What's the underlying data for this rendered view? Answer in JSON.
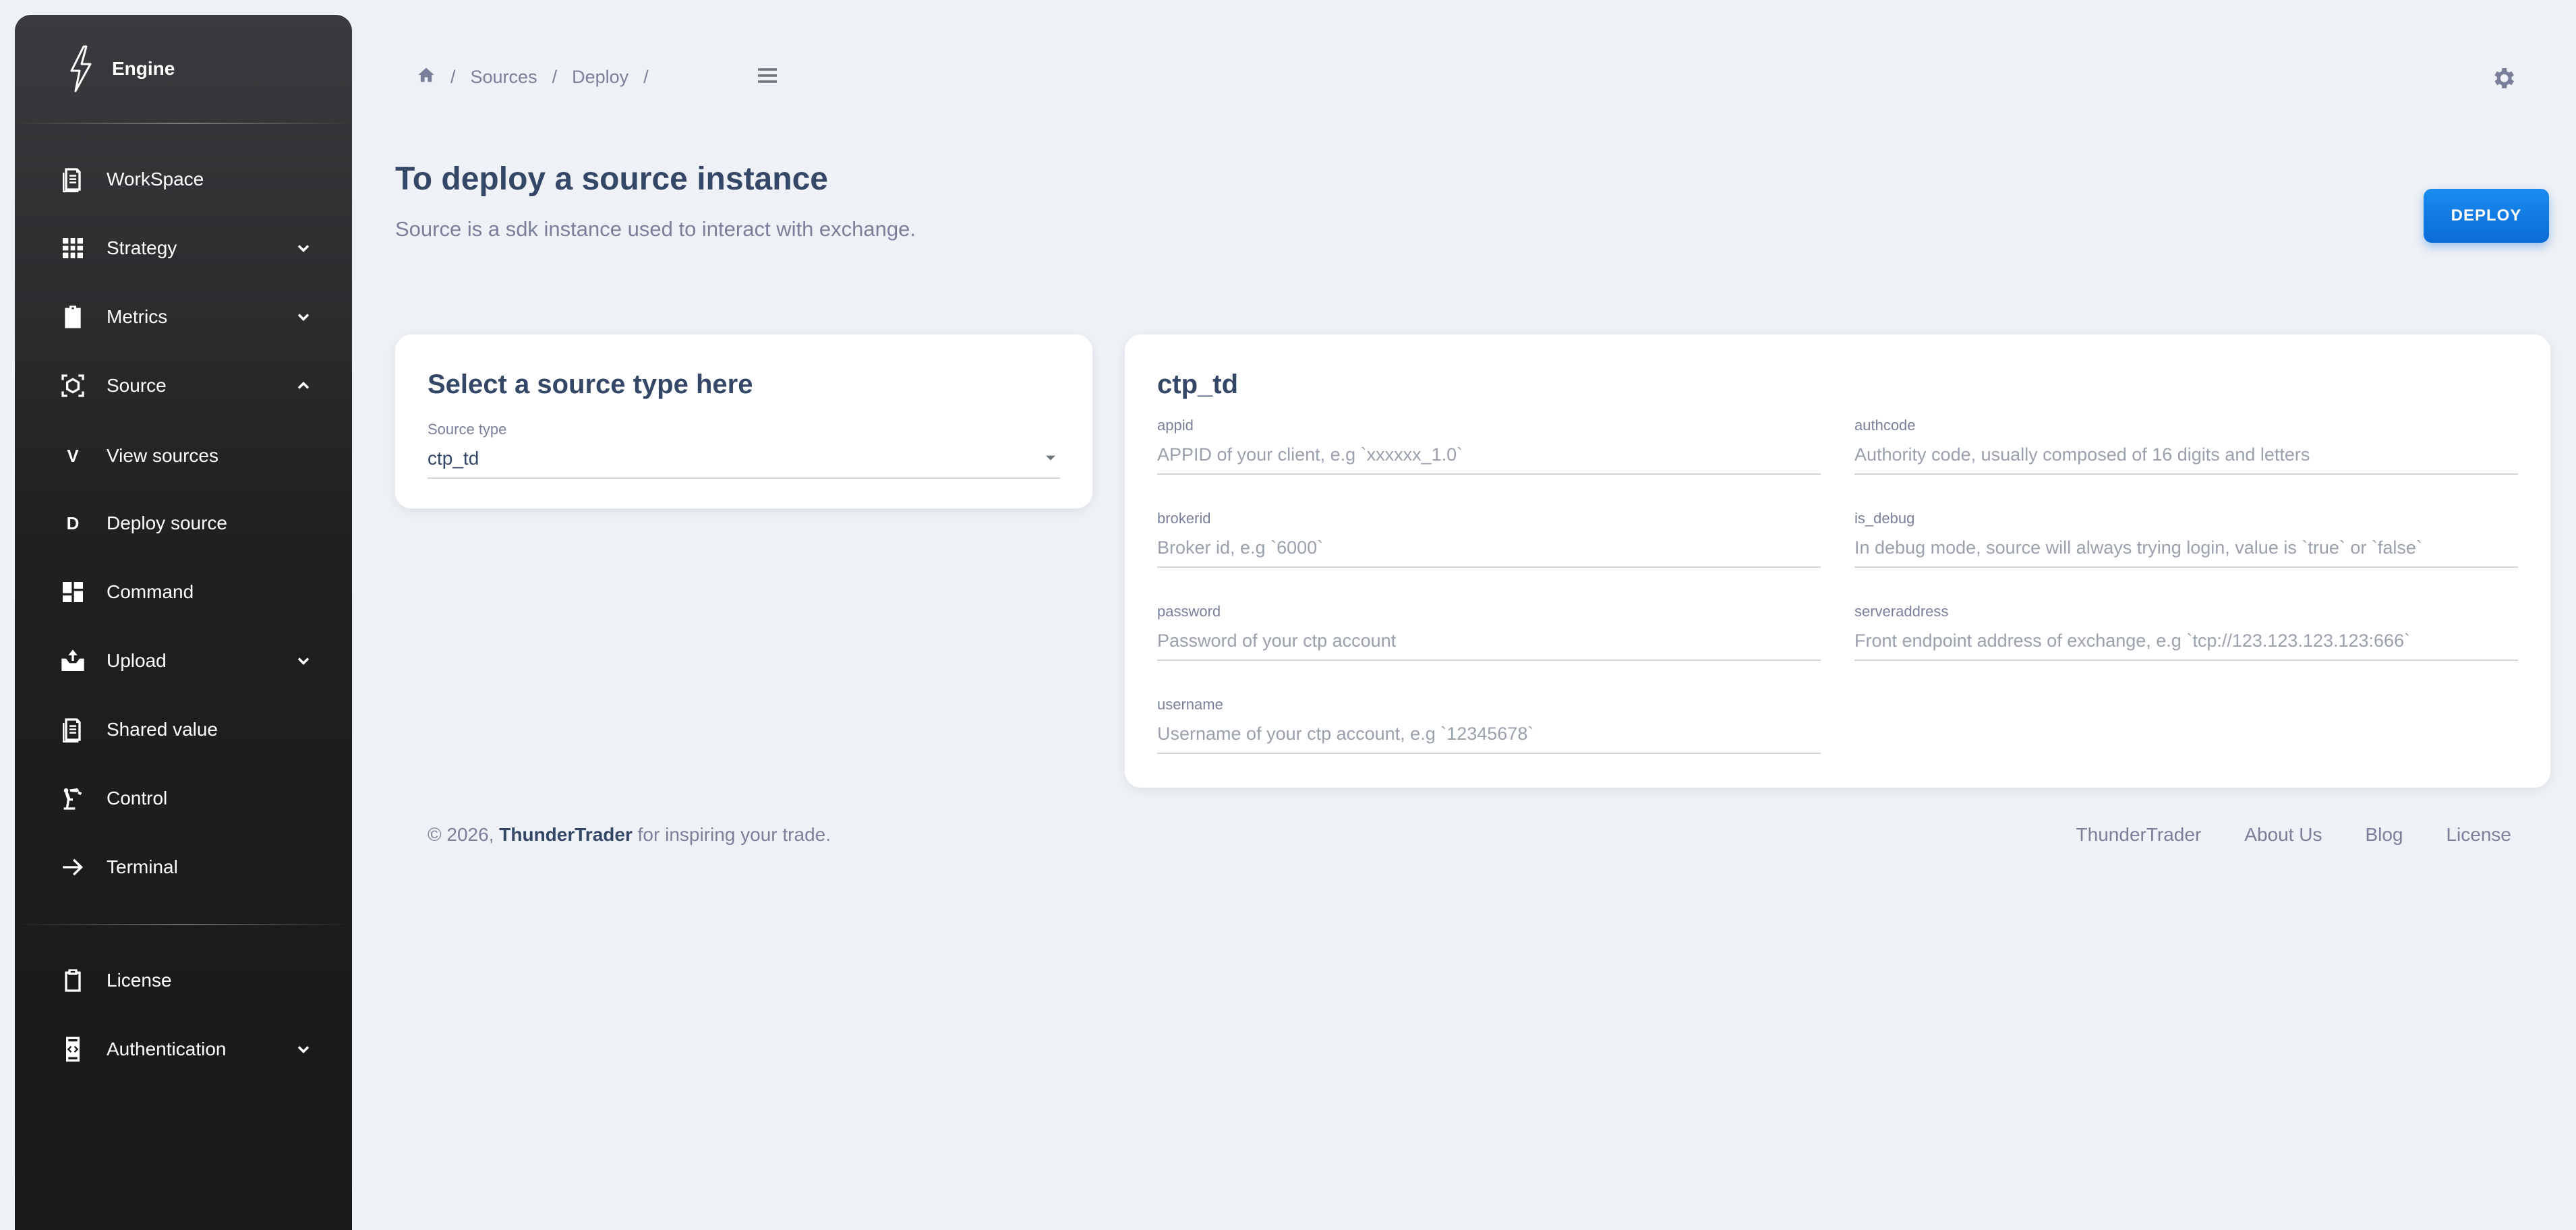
{
  "sidebar": {
    "brand": "Engine",
    "items": [
      {
        "label": "WorkSpace"
      },
      {
        "label": "Strategy"
      },
      {
        "label": "Metrics"
      },
      {
        "label": "Source"
      },
      {
        "letter": "V",
        "label": "View sources"
      },
      {
        "letter": "D",
        "label": "Deploy source"
      },
      {
        "label": "Command"
      },
      {
        "label": "Upload"
      },
      {
        "label": "Shared value"
      },
      {
        "label": "Control"
      },
      {
        "label": "Terminal"
      },
      {
        "label": "License"
      },
      {
        "label": "Authentication"
      }
    ]
  },
  "breadcrumb": {
    "items": [
      "Sources",
      "Deploy"
    ],
    "separator": "/"
  },
  "header": {
    "title": "To deploy a source instance",
    "subtitle": "Source is a sdk instance used to interact with exchange.",
    "deploy_label": "DEPLOY"
  },
  "source_select": {
    "title": "Select a source type here",
    "label": "Source type",
    "value": "ctp_td"
  },
  "config": {
    "title": "ctp_td",
    "fields": [
      {
        "label": "appid",
        "placeholder": "APPID of your client, e.g `xxxxxx_1.0`",
        "value": ""
      },
      {
        "label": "authcode",
        "placeholder": "Authority code, usually composed of 16 digits and letters",
        "value": ""
      },
      {
        "label": "brokerid",
        "placeholder": "Broker id, e.g `6000`",
        "value": ""
      },
      {
        "label": "is_debug",
        "placeholder": "In debug mode, source will always trying login, value is `true` or `false`",
        "value": ""
      },
      {
        "label": "password",
        "placeholder": "Password of your ctp account",
        "value": ""
      },
      {
        "label": "serveraddress",
        "placeholder": "Front endpoint address of exchange, e.g `tcp://123.123.123.123:666`",
        "value": ""
      },
      {
        "label": "username",
        "placeholder": "Username of your ctp account, e.g `12345678`",
        "value": ""
      }
    ]
  },
  "footer": {
    "copy_prefix": "© 2026, ",
    "copy_brand": "ThunderTrader",
    "copy_suffix": " for inspiring your trade.",
    "links": [
      "ThunderTrader",
      "About Us",
      "Blog",
      "License"
    ]
  }
}
